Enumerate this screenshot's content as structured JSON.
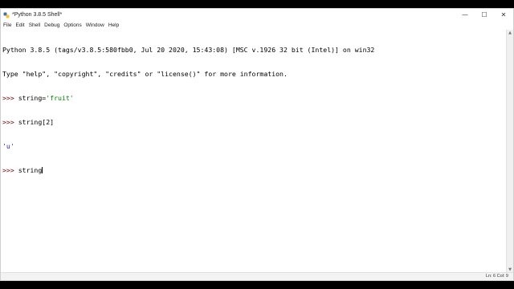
{
  "window": {
    "title": "*Python 3.8.5 Shell*",
    "controls": {
      "minimize": "—",
      "maximize": "☐",
      "close": "✕"
    }
  },
  "menu": [
    "File",
    "Edit",
    "Shell",
    "Debug",
    "Options",
    "Window",
    "Help"
  ],
  "shell": {
    "banner_line1": "Python 3.8.5 (tags/v3.8.5:580fbb0, Jul 20 2020, 15:43:08) [MSC v.1926 32 bit (Intel)] on win32",
    "banner_line2": "Type \"help\", \"copyright\", \"credits\" or \"license()\" for more information.",
    "prompt": ">>> ",
    "cmd1_code": "string=",
    "cmd1_string": "'fruit'",
    "cmd2_code": "string[2]",
    "output1": "'u'",
    "cmd3_code": "string"
  },
  "status": {
    "position": "Ln: 6  Col: 9"
  },
  "colors": {
    "prompt": "#7f0000",
    "string": "#008000",
    "output": "#2020c0"
  },
  "icons": {
    "app": "python-logo-icon"
  }
}
